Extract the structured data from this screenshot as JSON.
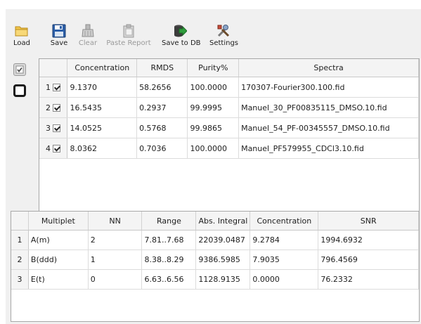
{
  "toolbar": {
    "load": "Load",
    "save": "Save",
    "clear": "Clear",
    "paste_report": "Paste Report",
    "save_to_db": "Save to DB",
    "settings": "Settings"
  },
  "icons": {
    "load": "folder-icon",
    "save": "floppy-disk-icon",
    "clear": "broom-icon",
    "paste_report": "clipboard-icon",
    "save_to_db": "database-arrow-icon",
    "settings": "tools-icon"
  },
  "colors": {
    "folder": "#f2c54a",
    "floppy": "#2c5fa8",
    "db_green": "#2e9d3c",
    "disabled_text": "#9a9a9a"
  },
  "spectra_table": {
    "headers": [
      "Concentration",
      "RMDS",
      "Purity%",
      "Spectra"
    ],
    "rows": [
      {
        "num": "1",
        "checked": true,
        "concentration": "9.1370",
        "rmds": "58.2656",
        "purity": "100.0000",
        "spectra": "170307-Fourier300.100.fid"
      },
      {
        "num": "2",
        "checked": true,
        "concentration": "16.5435",
        "rmds": "0.2937",
        "purity": "99.9995",
        "spectra": "Manuel_30_PF00835115_DMSO.10.fid"
      },
      {
        "num": "3",
        "checked": true,
        "concentration": "14.0525",
        "rmds": "0.5768",
        "purity": "99.9865",
        "spectra": "Manuel_54_PF-00345557_DMSO.10.fid"
      },
      {
        "num": "4",
        "checked": true,
        "concentration": "8.0362",
        "rmds": "0.7036",
        "purity": "100.0000",
        "spectra": "Manuel_PF579955_CDCl3.10.fid"
      }
    ]
  },
  "multiplet_table": {
    "headers": [
      "Multiplet",
      "NN",
      "Range",
      "Abs. Integral",
      "Concentration",
      "SNR"
    ],
    "rows": [
      {
        "num": "1",
        "multiplet": "A(m)",
        "nn": "2",
        "range": "7.81..7.68",
        "abs_integral": "22039.0487",
        "concentration": "9.2784",
        "snr": "1994.6932"
      },
      {
        "num": "2",
        "multiplet": "B(ddd)",
        "nn": "1",
        "range": "8.38..8.29",
        "abs_integral": "9386.5985",
        "concentration": "7.9035",
        "snr": "796.4569"
      },
      {
        "num": "3",
        "multiplet": "E(t)",
        "nn": "0",
        "range": "6.63..6.56",
        "abs_integral": "1128.9135",
        "concentration": "0.0000",
        "snr": "76.2332"
      }
    ]
  }
}
